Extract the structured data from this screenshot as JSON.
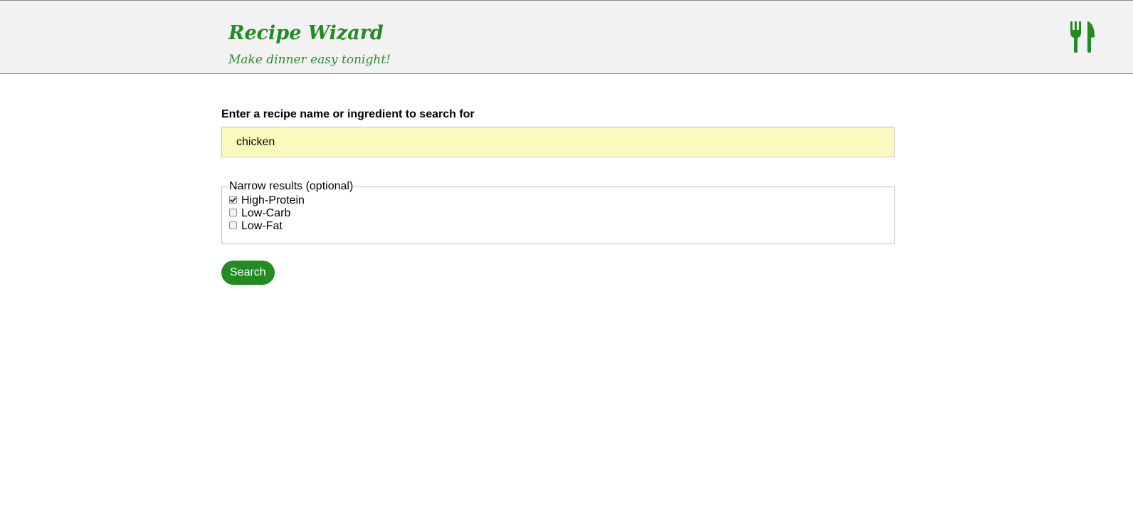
{
  "header": {
    "title": "Recipe Wizard",
    "tagline": "Make dinner easy tonight!",
    "icon": "fork-knife-icon",
    "brand_color": "#228b22",
    "background_color": "#f2f2f2"
  },
  "search": {
    "label": "Enter a recipe name or ingredient to search for",
    "value": "chicken",
    "field_background": "#fafabf"
  },
  "filters": {
    "legend": "Narrow results (optional)",
    "options": [
      {
        "label": "High-Protein",
        "checked": true
      },
      {
        "label": "Low-Carb",
        "checked": false
      },
      {
        "label": "Low-Fat",
        "checked": false
      }
    ]
  },
  "actions": {
    "search_label": "Search",
    "button_color": "#228b22"
  }
}
